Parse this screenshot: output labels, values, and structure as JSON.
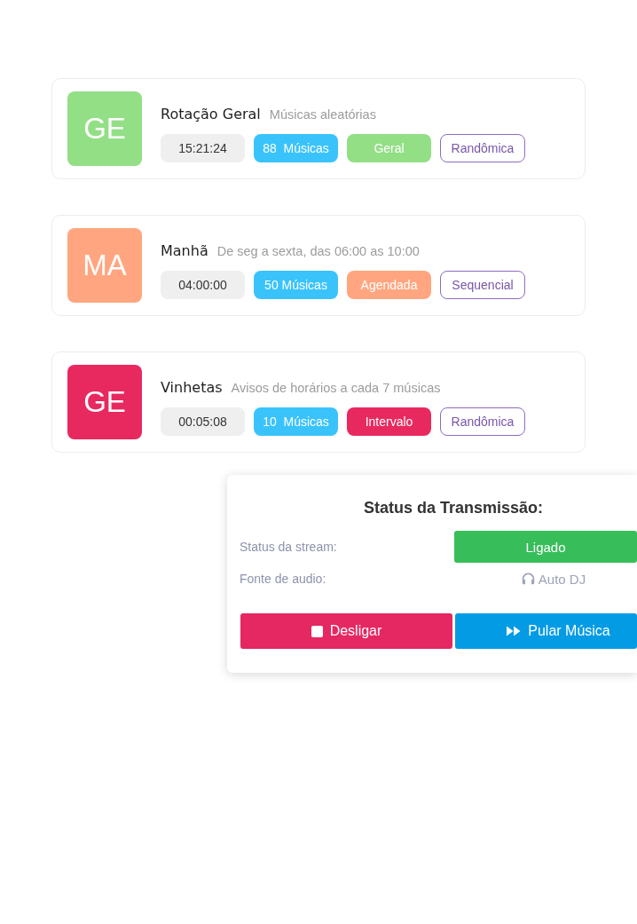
{
  "cards": [
    {
      "initials": "GE",
      "color": "#93df86",
      "title": "Rotação Geral",
      "subtitle": "Músicas aleatórias",
      "duration": "15:21:24",
      "count": "88  Músicas",
      "type": "Geral",
      "order": "Randômica"
    },
    {
      "initials": "MA",
      "color": "#ffa680",
      "title": "Manhã",
      "subtitle": "De seg a sexta, das 06:00 as 10:00",
      "duration": "04:00:00",
      "count": "50 Músicas",
      "type": "Agendada",
      "order": "Sequencial"
    },
    {
      "initials": "GE",
      "color": "#e8295f",
      "title": "Vinhetas",
      "subtitle": "Avisos de horários a cada 7 músicas",
      "duration": "00:05:08",
      "count": "10  Músicas",
      "type": "Intervalo",
      "order": "Randômica"
    }
  ],
  "stream_panel": {
    "title": "Status da Transmissão:",
    "rows": [
      {
        "kind": "badge",
        "label": "Status da stream:",
        "value": "Ligado"
      },
      {
        "kind": "source",
        "label": "Fonte de audio:",
        "value": "Auto DJ"
      }
    ],
    "buttons": [
      {
        "kind": "stop",
        "label": "Desligar"
      },
      {
        "kind": "skip",
        "label": "Pular Música"
      }
    ]
  }
}
